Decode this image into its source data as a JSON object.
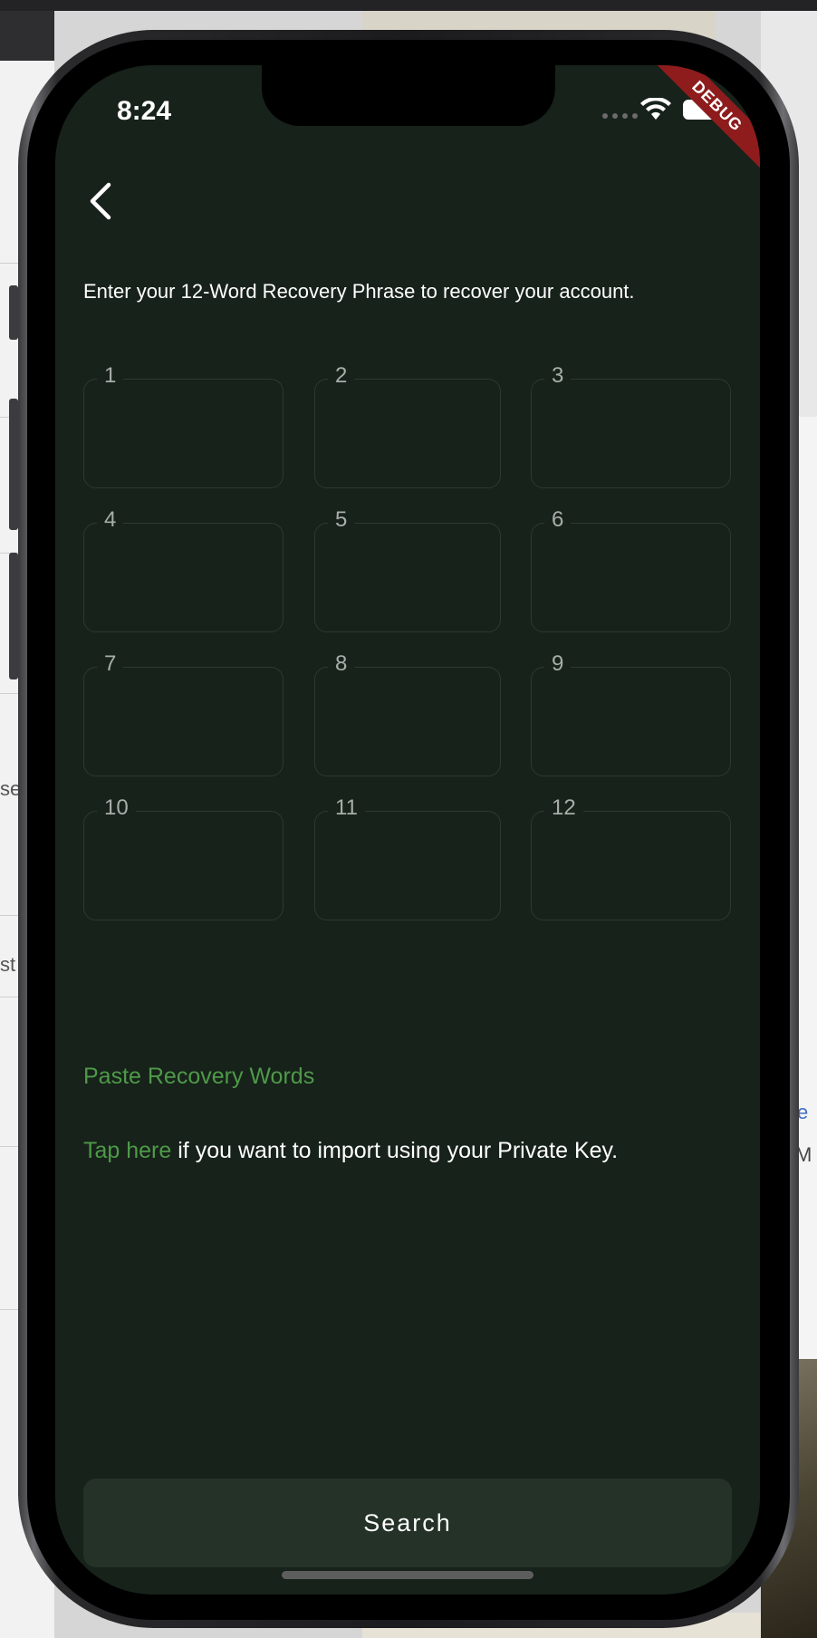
{
  "status_bar": {
    "time": "8:24"
  },
  "debug_banner": "DEBUG",
  "instruction": "Enter your 12-Word Recovery Phrase to recover your account.",
  "words": [
    {
      "label": "1",
      "value": ""
    },
    {
      "label": "2",
      "value": ""
    },
    {
      "label": "3",
      "value": ""
    },
    {
      "label": "4",
      "value": ""
    },
    {
      "label": "5",
      "value": ""
    },
    {
      "label": "6",
      "value": ""
    },
    {
      "label": "7",
      "value": ""
    },
    {
      "label": "8",
      "value": ""
    },
    {
      "label": "9",
      "value": ""
    },
    {
      "label": "10",
      "value": ""
    },
    {
      "label": "11",
      "value": ""
    },
    {
      "label": "12",
      "value": ""
    }
  ],
  "paste_link": "Paste Recovery Words",
  "private_key": {
    "link": "Tap here",
    "text": " if you want to import using your Private Key."
  },
  "search_button": "Search",
  "background": {
    "left_text_1": "se",
    "left_text_2": "st",
    "right_text_1": "e",
    "right_text_2": "M"
  },
  "colors": {
    "screen_bg": "#17221a",
    "accent_green": "#4e9a49",
    "button_bg": "#243227",
    "box_border": "#2c3a30",
    "debug_red": "#8e1c1c"
  },
  "icons": {
    "back": "chevron-left-icon",
    "wifi": "wifi-icon",
    "battery": "battery-icon",
    "signal": "cellular-signal-icon"
  }
}
